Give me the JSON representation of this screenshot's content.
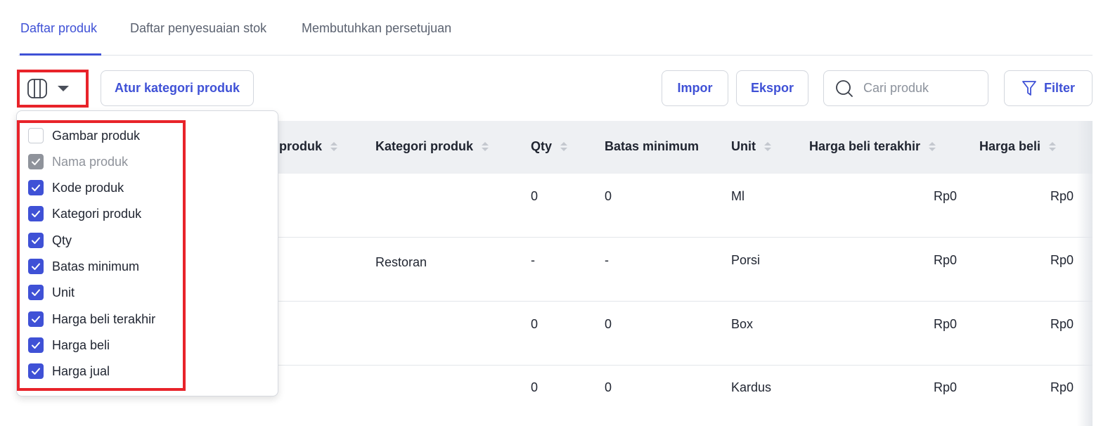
{
  "tabs": [
    {
      "label": "Daftar produk",
      "active": true
    },
    {
      "label": "Daftar penyesuaian stok",
      "active": false
    },
    {
      "label": "Membutuhkan persetujuan",
      "active": false
    }
  ],
  "toolbar": {
    "column_toggle_icon": "columns-icon",
    "kategori_label": "Atur kategori produk",
    "impor_label": "Impor",
    "ekspor_label": "Ekspor",
    "search_placeholder": "Cari produk",
    "filter_label": "Filter"
  },
  "column_options": [
    {
      "label": "Gambar produk",
      "checked": false,
      "disabled": false
    },
    {
      "label": "Nama produk",
      "checked": true,
      "disabled": true
    },
    {
      "label": "Kode produk",
      "checked": true,
      "disabled": false
    },
    {
      "label": "Kategori produk",
      "checked": true,
      "disabled": false
    },
    {
      "label": "Qty",
      "checked": true,
      "disabled": false
    },
    {
      "label": "Batas minimum",
      "checked": true,
      "disabled": false
    },
    {
      "label": "Unit",
      "checked": true,
      "disabled": false
    },
    {
      "label": "Harga beli terakhir",
      "checked": true,
      "disabled": false
    },
    {
      "label": "Harga beli",
      "checked": true,
      "disabled": false
    },
    {
      "label": "Harga jual",
      "checked": true,
      "disabled": false
    }
  ],
  "table": {
    "headers": {
      "kode": "produk",
      "kategori": "Kategori produk",
      "qty": "Qty",
      "batas": "Batas minimum",
      "unit": "Unit",
      "harga_terakhir": "Harga beli terakhir",
      "harga_beli": "Harga beli"
    },
    "rows": [
      {
        "kategori": "",
        "qty": "0",
        "batas": "0",
        "unit": "Ml",
        "harga_terakhir": "Rp0",
        "harga_beli": "Rp0"
      },
      {
        "kategori": "Restoran",
        "qty": "-",
        "batas": "-",
        "unit": "Porsi",
        "harga_terakhir": "Rp0",
        "harga_beli": "Rp0"
      },
      {
        "kategori": "",
        "qty": "0",
        "batas": "0",
        "unit": "Box",
        "harga_terakhir": "Rp0",
        "harga_beli": "Rp0"
      },
      {
        "kategori": "",
        "qty": "0",
        "batas": "0",
        "unit": "Kardus",
        "harga_terakhir": "Rp0",
        "harga_beli": "Rp0"
      }
    ]
  },
  "colors": {
    "accent": "#3f51d6",
    "highlight": "#e8232a"
  }
}
